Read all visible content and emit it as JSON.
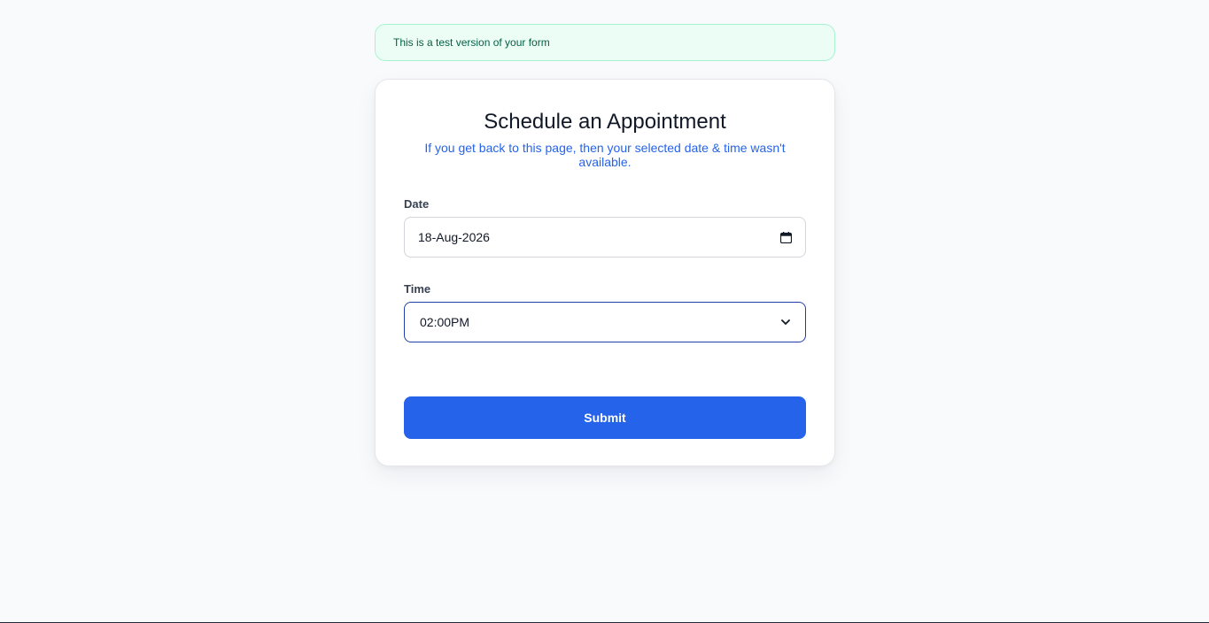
{
  "banner": {
    "text": "This is a test version of your form"
  },
  "form": {
    "title": "Schedule an Appointment",
    "subtitle": "If you get back to this page, then your selected date & time wasn't available.",
    "date": {
      "label": "Date",
      "value": "18-Aug-2026",
      "icon": "calendar-icon"
    },
    "time": {
      "label": "Time",
      "value": "02:00PM",
      "icon": "chevron-down-icon"
    },
    "submit_label": "Submit"
  },
  "colors": {
    "accent": "#2563eb",
    "banner_bg": "#ecfdf5",
    "banner_text": "#065f46",
    "focus_border": "#1e40af"
  }
}
